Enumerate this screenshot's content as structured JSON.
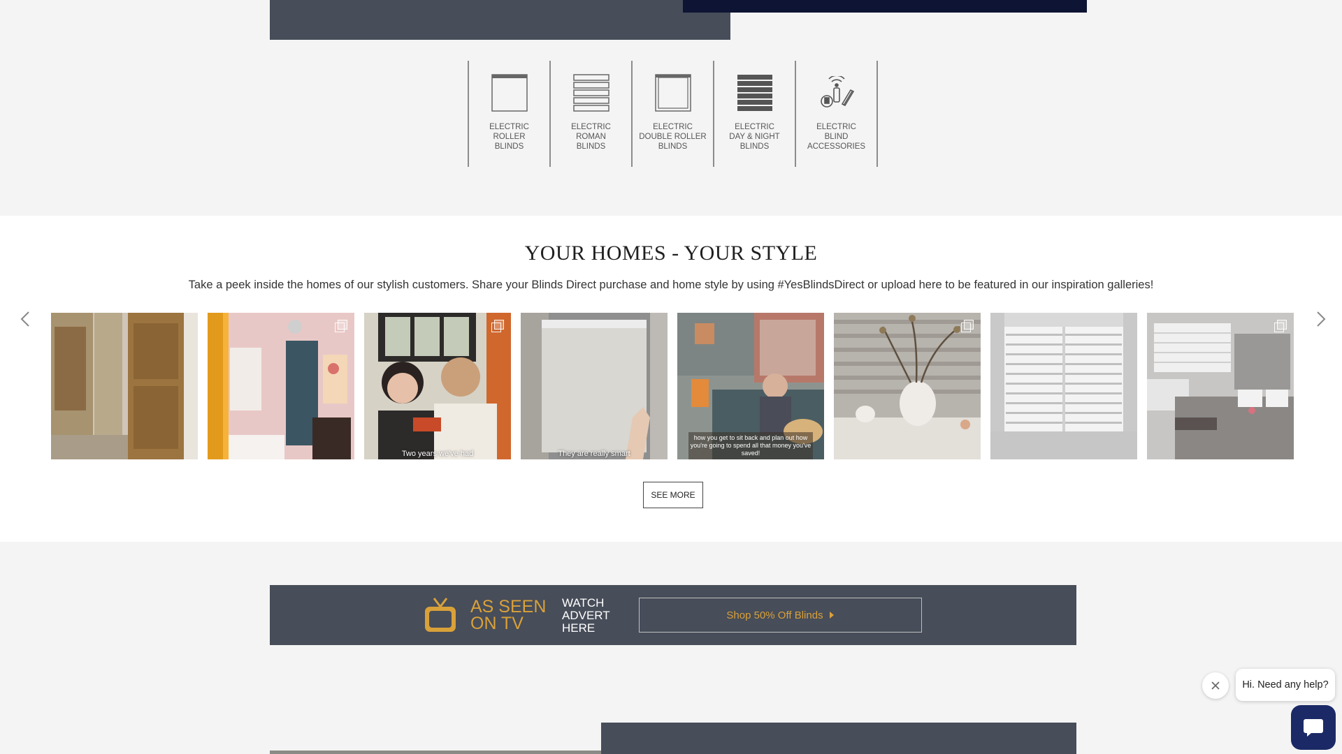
{
  "categories": [
    {
      "label": "ELECTRIC\nROLLER\nBLINDS",
      "icon": "roller-blind-icon"
    },
    {
      "label": "ELECTRIC\nROMAN\nBLINDS",
      "icon": "roman-blind-icon"
    },
    {
      "label": "ELECTRIC\nDOUBLE ROLLER\nBLINDS",
      "icon": "double-roller-blind-icon"
    },
    {
      "label": "ELECTRIC\nDAY & NIGHT\nBLINDS",
      "icon": "day-night-blind-icon"
    },
    {
      "label": "ELECTRIC\nBLIND\nACCESSORIES",
      "icon": "blind-accessories-icon"
    }
  ],
  "homes": {
    "title": "YOUR HOMES - YOUR STYLE",
    "subtitle": "Take a peek inside the homes of our stylish customers. Share your Blinds Direct purchase and home style by using #YesBlindsDirect or upload here to be featured in our inspiration galleries!",
    "see_more": "SEE MORE",
    "gallery": [
      {
        "caption": ""
      },
      {
        "caption": ""
      },
      {
        "caption": "Two years we've had"
      },
      {
        "caption": "They are really smart"
      },
      {
        "caption": "how you get to sit back and plan out how you're going to spend all that money you've saved!"
      },
      {
        "caption": ""
      },
      {
        "caption": ""
      },
      {
        "caption": ""
      }
    ]
  },
  "tv_banner": {
    "as_seen": "AS SEEN\nON TV",
    "watch": "WATCH\nADVERT\nHERE",
    "shop_label": "Shop 50% Off Blinds",
    "accent": "#d9a13a"
  },
  "chat": {
    "greeting": "Hi. Need any help?"
  },
  "colors": {
    "slate": "#474d59",
    "navy": "#0e1433",
    "chat_button": "#1b2a66"
  }
}
